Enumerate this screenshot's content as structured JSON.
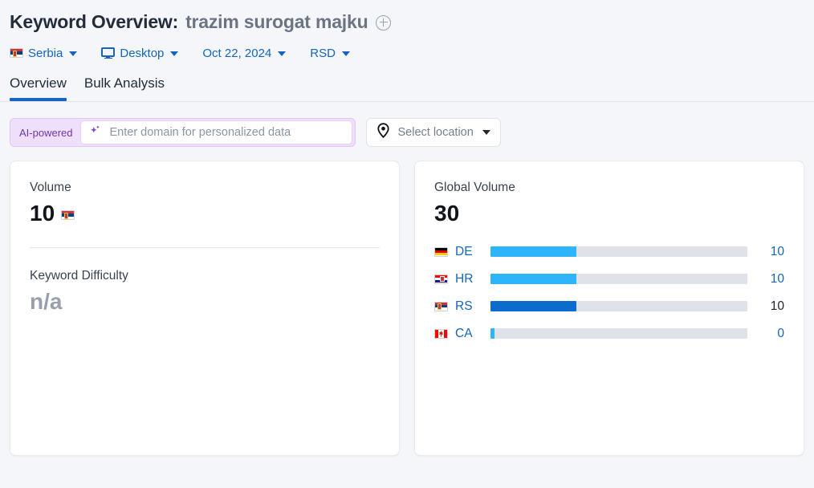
{
  "header": {
    "title_prefix": "Keyword Overview:",
    "keyword": "trazim surogat majku",
    "add_icon": "plus-circle-icon",
    "filters": [
      {
        "name": "country",
        "label": "Serbia",
        "icon": "flag-rs-icon"
      },
      {
        "name": "device",
        "label": "Desktop",
        "icon": "monitor-icon"
      },
      {
        "name": "date",
        "label": "Oct 22, 2024",
        "icon": ""
      },
      {
        "name": "currency",
        "label": "RSD",
        "icon": ""
      }
    ]
  },
  "tabs": [
    {
      "label": "Overview",
      "active": true
    },
    {
      "label": "Bulk Analysis",
      "active": false
    }
  ],
  "search": {
    "ai_badge": "AI-powered",
    "domain_placeholder": "Enter domain for personalized data",
    "domain_value": "",
    "sparkle_icon": "sparkle-icon",
    "location_label": "Select location",
    "location_icon": "map-pin-icon",
    "location_caret": "chevron-down-icon"
  },
  "cards": {
    "volume": {
      "label": "Volume",
      "value": "10",
      "flag": "flag-rs-icon"
    },
    "difficulty": {
      "label": "Keyword Difficulty",
      "value": "n/a"
    },
    "global": {
      "label": "Global Volume",
      "value": "30"
    }
  },
  "chart_data": {
    "type": "bar",
    "title": "Global Volume",
    "total": 30,
    "categories": [
      "DE",
      "HR",
      "RS",
      "CA"
    ],
    "values": [
      10,
      10,
      10,
      0
    ],
    "value_labels": [
      "10",
      "10",
      "10",
      "0"
    ],
    "bar_max": 30,
    "bar_fill_pct": [
      33.3,
      33.3,
      33.3,
      1.5
    ],
    "highlight_index": 2,
    "colors": {
      "bar": "#2eb4fb",
      "bar_highlight": "#0b6cce",
      "track": "#dfe2e8",
      "value_text": "#1565c0",
      "value_text_highlight": "#22272f"
    },
    "flags": [
      "flag-de-icon",
      "flag-hr-icon",
      "flag-rs-icon",
      "flag-ca-icon"
    ],
    "xlabel": "",
    "ylabel": "",
    "grid": false,
    "legend": "none"
  },
  "theme": {
    "page_bg": "#f4f6f9",
    "accent": "#1565c0",
    "ai_bg": "#f0dffb",
    "ai_text": "#6b38a8"
  }
}
